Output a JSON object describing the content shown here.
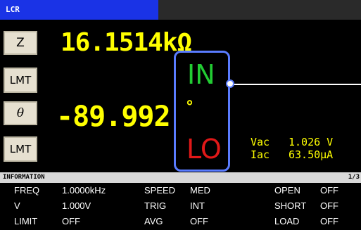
{
  "title": "LCR",
  "params": [
    {
      "label": "Z",
      "value": "16.1514kΩ"
    },
    {
      "label": "LMT"
    },
    {
      "label": "θ",
      "value": "-89.992"
    },
    {
      "label": "LMT"
    }
  ],
  "judgement": {
    "upper": "IN",
    "lower": "LO",
    "degree": "°"
  },
  "monitor": {
    "vac_label": "Vac",
    "vac_value": "1.026 V",
    "iac_label": "Iac",
    "iac_value": "63.50μA"
  },
  "info_bar": {
    "label": "INFORMATION",
    "page": "1/3"
  },
  "info_rows": [
    {
      "c1l": "FREQ",
      "c1v": "1.0000kHz",
      "c2l": "SPEED",
      "c2v": "MED",
      "c3l": "OPEN",
      "c3v": "OFF"
    },
    {
      "c1l": "V",
      "c1v": "1.000V",
      "c2l": "TRIG",
      "c2v": "INT",
      "c3l": "SHORT",
      "c3v": "OFF"
    },
    {
      "c1l": "LIMIT",
      "c1v": "OFF",
      "c2l": "AVG",
      "c2v": "OFF",
      "c3l": "LOAD",
      "c3v": "OFF"
    }
  ],
  "colors": {
    "accent": "#1a33e6",
    "value": "#ffff00",
    "in": "#22cc33",
    "lo": "#e01818",
    "callout": "#5a7cff"
  }
}
